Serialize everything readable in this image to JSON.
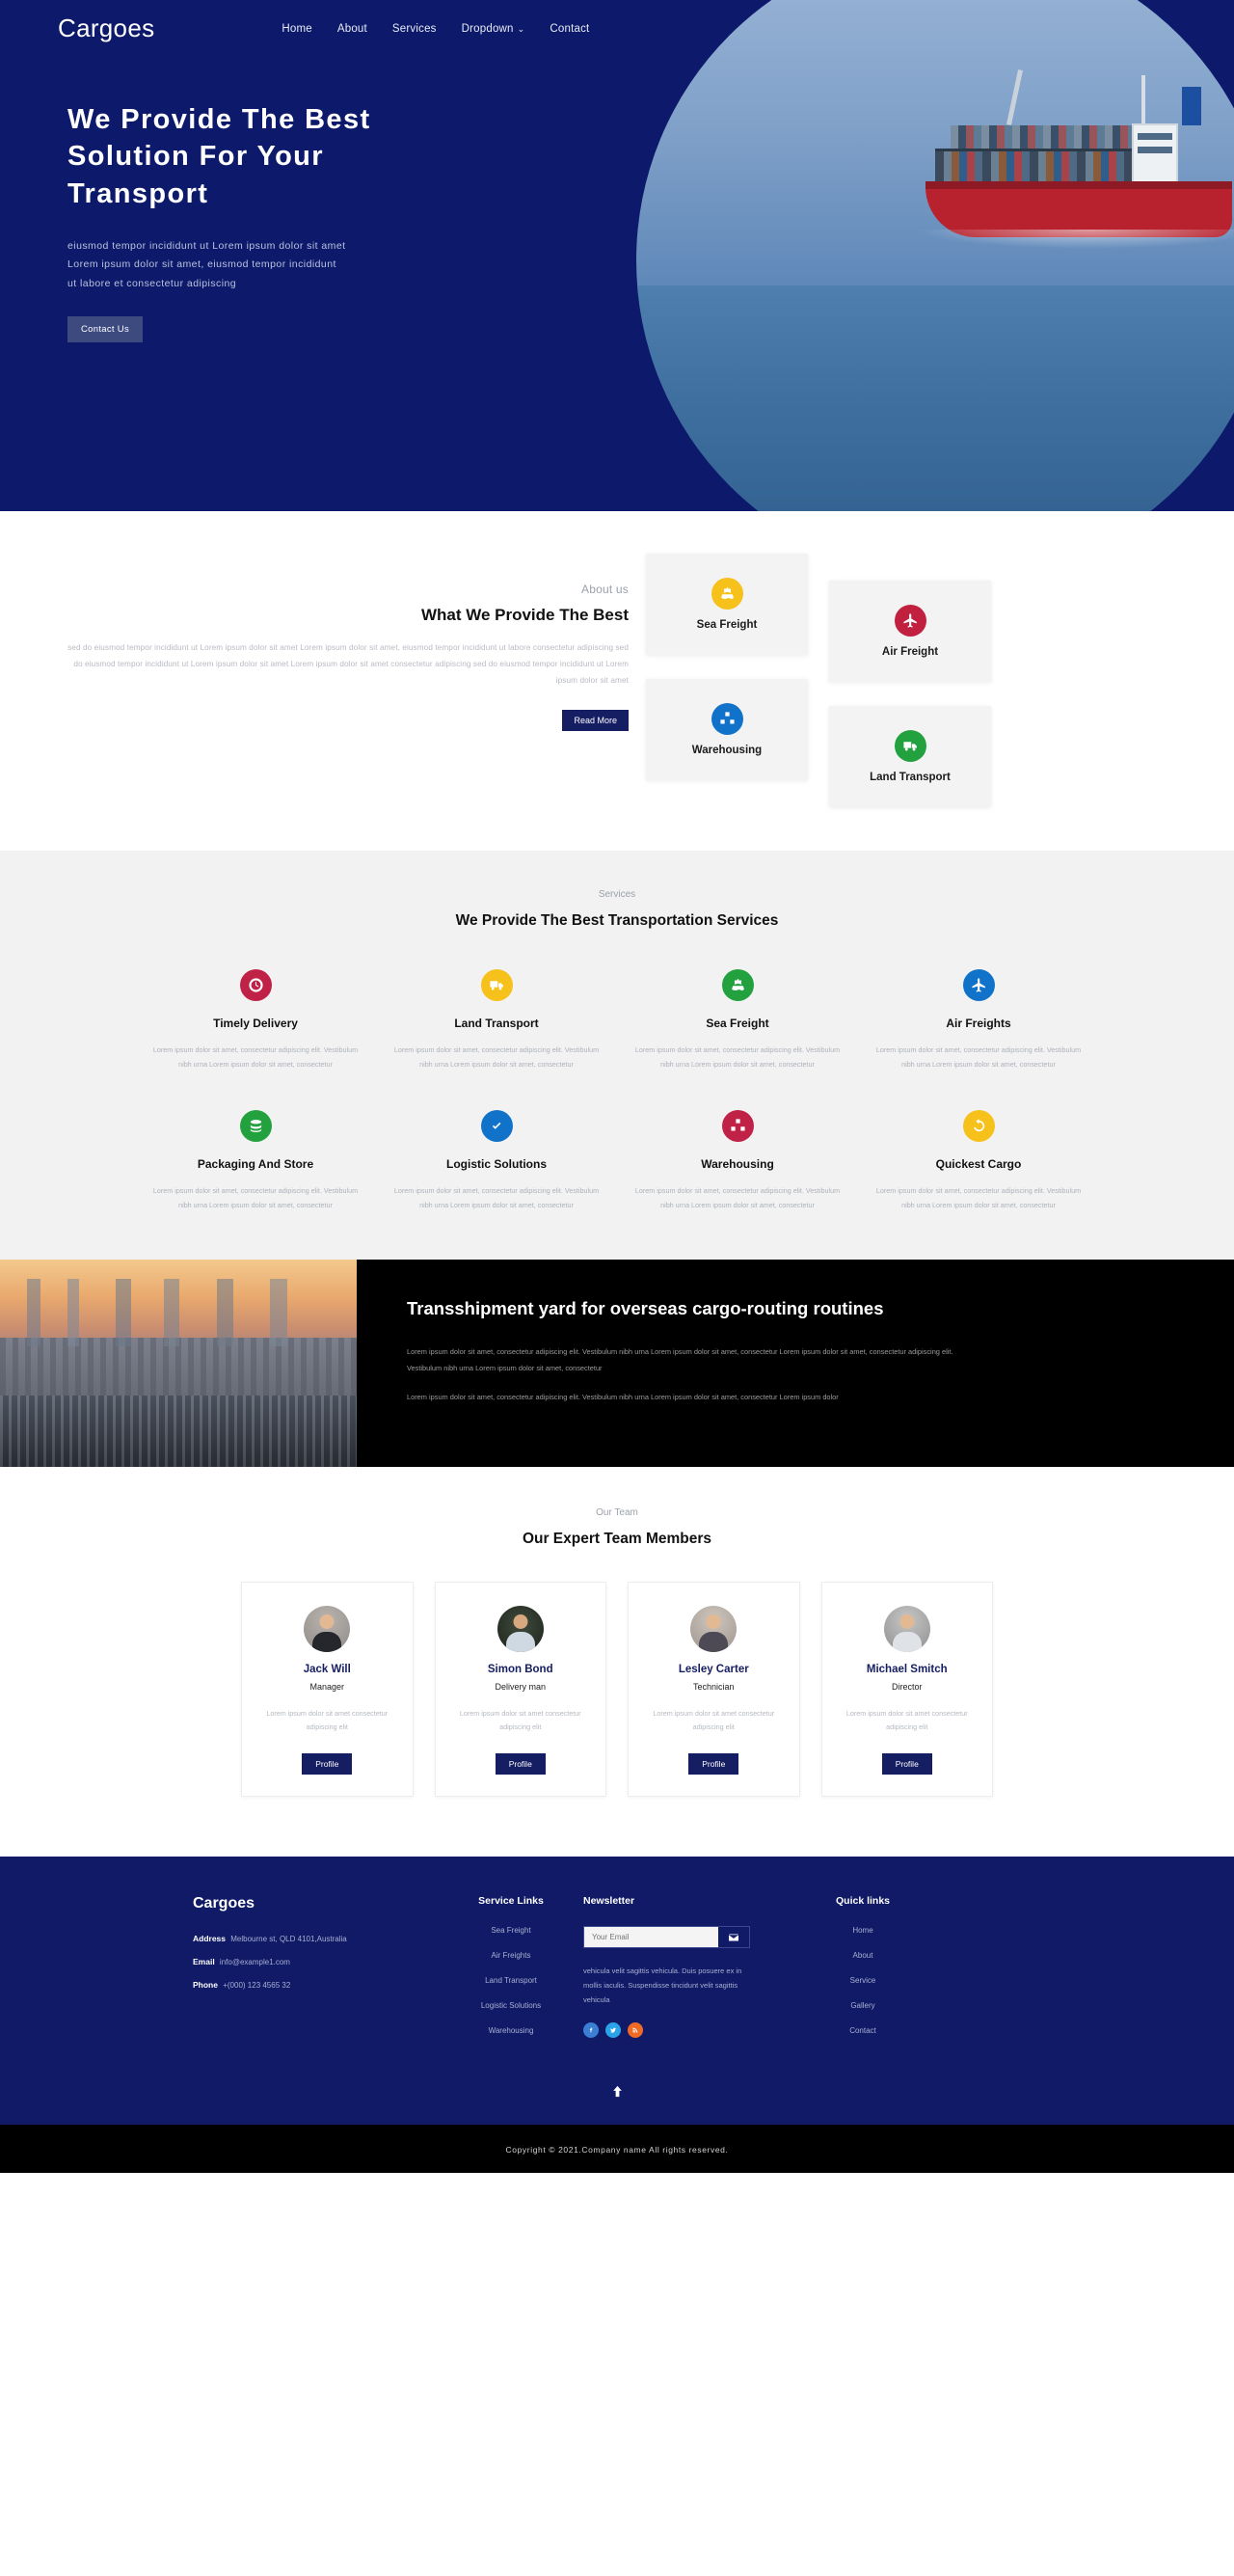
{
  "brand": "Cargoes",
  "nav": {
    "items": [
      {
        "label": "Home"
      },
      {
        "label": "About"
      },
      {
        "label": "Services"
      },
      {
        "label": "Dropdown"
      },
      {
        "label": "Contact"
      }
    ],
    "dropdown_caret": "⌄"
  },
  "hero": {
    "title": "We Provide The Best Solution For Your Transport",
    "subtitle": "eiusmod tempor incididunt ut Lorem ipsum dolor sit amet Lorem ipsum dolor sit amet, eiusmod tempor incididunt ut labore et consectetur adipiscing",
    "cta": "Contact Us"
  },
  "about": {
    "eyebrow": "About us",
    "title": "What We Provide The Best",
    "text": "sed do eiusmod tempor incididunt ut Lorem ipsum dolor sit amet Lorem ipsum dolor sit amet, eiusmod tempor incididunt ut labore consectetur adipiscing sed do eiusmod tempor incididunt ut Lorem ipsum dolor sit amet Lorem ipsum dolor sit amet consectetur adipiscing sed do eiusmod tempor incididunt ut Lorem ipsum dolor sit amet",
    "cta": "Read More",
    "cards": [
      {
        "label": "Sea Freight",
        "icon": "ship-icon",
        "color": "#f7c11b"
      },
      {
        "label": "Air Freight",
        "icon": "plane-icon",
        "color": "#c1203f"
      },
      {
        "label": "Warehousing",
        "icon": "boxes-icon",
        "color": "#1072c8"
      },
      {
        "label": "Land Transport",
        "icon": "truck-icon",
        "color": "#23a13f"
      }
    ]
  },
  "services": {
    "eyebrow": "Services",
    "title": "We Provide The Best Transportation Services",
    "desc": "Lorem ipsum dolor sit amet, consectetur adipiscing elit. Vestibulum nibh urna Lorem ipsum dolor sit amet, consectetur",
    "items": [
      {
        "title": "Timely Delivery",
        "icon": "clock-icon",
        "color": "#bf2246"
      },
      {
        "title": "Land Transport",
        "icon": "truck-icon",
        "color": "#f7c11b"
      },
      {
        "title": "Sea Freight",
        "icon": "ship-icon",
        "color": "#23a13f"
      },
      {
        "title": "Air Freights",
        "icon": "plane-icon",
        "color": "#1072c8"
      },
      {
        "title": "Packaging And Store",
        "icon": "stack-icon",
        "color": "#23a13f"
      },
      {
        "title": "Logistic Solutions",
        "icon": "check-icon",
        "color": "#1072c8"
      },
      {
        "title": "Warehousing",
        "icon": "boxes-icon",
        "color": "#bf2246"
      },
      {
        "title": "Quickest Cargo",
        "icon": "refresh-icon",
        "color": "#f7c11b"
      }
    ]
  },
  "transshipment": {
    "title": "Transshipment yard for overseas cargo-routing routines",
    "paragraph1": "Lorem ipsum dolor sit amet, consectetur adipiscing elit. Vestibulum nibh urna Lorem ipsum dolor sit amet, consectetur Lorem ipsum dolor sit amet, consectetur adipiscing elit. Vestibulum nibh urna Lorem ipsum dolor sit amet, consectetur",
    "paragraph2": "Lorem ipsum dolor sit amet, consectetur adipiscing elit. Vestibulum nibh urna Lorem ipsum dolor sit amet, consectetur Lorem ipsum dolor"
  },
  "team": {
    "eyebrow": "Our Team",
    "title": "Our Expert Team Members",
    "desc": "Lorem ipsum dolor sit amet consectetur adipiscing elit",
    "button": "Profile",
    "members": [
      {
        "name": "Jack Will",
        "role": "Manager"
      },
      {
        "name": "Simon Bond",
        "role": "Delivery man"
      },
      {
        "name": "Lesley Carter",
        "role": "Technician"
      },
      {
        "name": "Michael Smitch",
        "role": "Director"
      }
    ]
  },
  "footer": {
    "brand": "Cargoes",
    "contact": [
      {
        "label": "Address",
        "value": "Melbourne st, QLD 4101,Australia"
      },
      {
        "label": "Email",
        "value": "info@example1.com"
      },
      {
        "label": "Phone",
        "value": "+(000) 123 4565 32"
      }
    ],
    "service_links_title": "Service Links",
    "service_links": [
      {
        "label": "Sea Freight"
      },
      {
        "label": "Air Freights"
      },
      {
        "label": "Land Transport"
      },
      {
        "label": "Logistic Solutions"
      },
      {
        "label": "Warehousing"
      }
    ],
    "newsletter_title": "Newsletter",
    "newsletter_placeholder": "Your Email",
    "newsletter_value": "",
    "newsletter_text": "vehicula velit sagittis vehicula. Duis posuere ex in mollis iaculis. Suspendisse tincidunt velit sagittis vehicula",
    "socials": [
      {
        "name": "facebook-icon",
        "color": "#3b7fd4"
      },
      {
        "name": "twitter-icon",
        "color": "#2aa3e8"
      },
      {
        "name": "rss-icon",
        "color": "#ef6a24"
      }
    ],
    "quick_links_title": "Quick links",
    "quick_links": [
      {
        "label": "Home"
      },
      {
        "label": "About"
      },
      {
        "label": "Service"
      },
      {
        "label": "Gallery"
      },
      {
        "label": "Contact"
      }
    ],
    "copyright": "Copyright © 2021.Company name All rights reserved."
  },
  "colors": {
    "navy": "#101a66",
    "hero_navy": "#0d1a6b",
    "accent_yellow": "#f7c11b",
    "accent_red": "#c1203f",
    "accent_blue": "#1072c8",
    "accent_green": "#23a13f"
  }
}
